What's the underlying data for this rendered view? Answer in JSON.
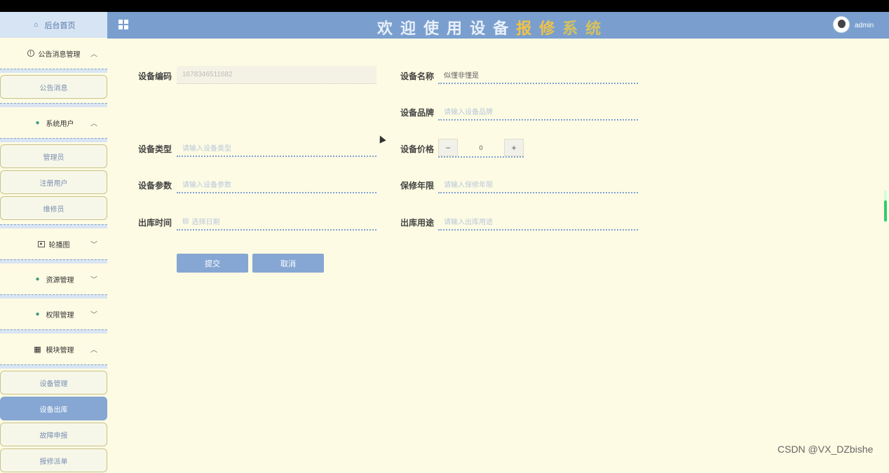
{
  "sidebar": {
    "home": "后台首页",
    "menus": [
      {
        "label": "公告消息管理",
        "chevron": "^",
        "items": [
          "公告消息"
        ]
      },
      {
        "label": "系统用户",
        "chevron": "^",
        "items": [
          "管理员",
          "注册用户",
          "维修员"
        ]
      },
      {
        "label": "轮播图",
        "chevron": "v",
        "items": []
      },
      {
        "label": "资源管理",
        "chevron": "v",
        "items": []
      },
      {
        "label": "权限管理",
        "chevron": "v",
        "items": []
      },
      {
        "label": "模块管理",
        "chevron": "^",
        "items": [
          "设备管理",
          "设备出库",
          "故障申报",
          "报修派单"
        ]
      }
    ],
    "active_item": "设备出库"
  },
  "header": {
    "title_chars": [
      "欢",
      "迎",
      "使",
      "用",
      "设",
      "备",
      "报",
      "修",
      "系",
      "统"
    ],
    "user": "admin"
  },
  "form": {
    "device_code": {
      "label": "设备编码",
      "value": "1678346511682"
    },
    "device_name": {
      "label": "设备名称",
      "value": "似懂非懂是"
    },
    "device_brand": {
      "label": "设备品牌",
      "placeholder": "请输入设备品牌"
    },
    "device_type": {
      "label": "设备类型",
      "placeholder": "请输入设备类型"
    },
    "device_price": {
      "label": "设备价格",
      "value": "0",
      "minus": "−",
      "plus": "+"
    },
    "device_params": {
      "label": "设备参数",
      "placeholder": "请输入设备参数"
    },
    "warranty": {
      "label": "保修年限",
      "placeholder": "请输入保修年限"
    },
    "out_time": {
      "label": "出库时间",
      "placeholder": "选择日期"
    },
    "out_purpose": {
      "label": "出库用途",
      "placeholder": "请输入出库用途"
    },
    "submit": "提交",
    "cancel": "取消"
  },
  "watermark": "CSDN @VX_DZbishe",
  "colors": {
    "header": "#7a9fcf",
    "background": "#fdfbe3",
    "accent": "#86a7d3",
    "title_highlight": "#f1c246"
  }
}
